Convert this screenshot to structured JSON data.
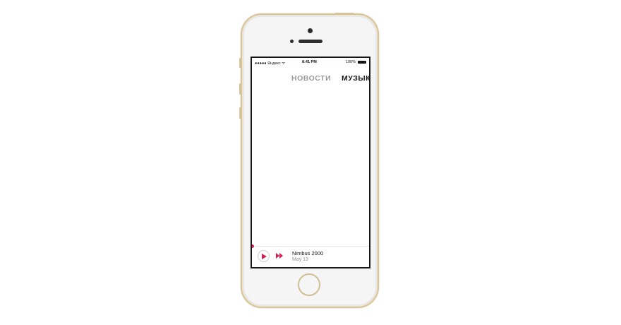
{
  "status_bar": {
    "carrier": "●●●●● Яндекс ᯤ",
    "time": "8:41 PM",
    "battery_text": "100%"
  },
  "tabs": [
    {
      "label": "НОВОСТИ",
      "active": false
    },
    {
      "label": "МУЗЫКА",
      "active": true
    }
  ],
  "player": {
    "track_title": "Nimbus 2000",
    "track_date": "May 13",
    "play_icon": "play-icon",
    "next_icon": "fast-forward-icon",
    "accent_color": "#d81b4f"
  },
  "device": {
    "frame_color": "#d9c59b",
    "body_color": "#f5f5f6"
  }
}
